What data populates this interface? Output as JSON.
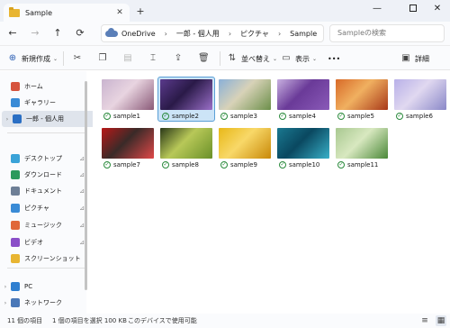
{
  "window": {
    "tab_title": "Sample",
    "tab_close": "✕",
    "new_tab": "+",
    "minimize": "—",
    "close": "✕"
  },
  "address": {
    "back": "←",
    "forward": "→",
    "up": "↑",
    "refresh": "⟳",
    "breadcrumb": [
      "OneDrive",
      "一郎 - 個人用",
      "ピクチャ",
      "Sample"
    ],
    "separator": "›",
    "search_placeholder": "Sampleの検索"
  },
  "toolbar": {
    "new_label": "新規作成",
    "sort_label": "並べ替え",
    "view_label": "表示",
    "more_label": "•••",
    "details_label": "詳細",
    "caret": "⌄"
  },
  "sidebar": {
    "items": [
      {
        "label": "ホーム",
        "color": "#d6543e",
        "pinned": false
      },
      {
        "label": "ギャラリー",
        "color": "#3a8bd6",
        "pinned": false
      },
      {
        "label": "一郎 - 個人用",
        "color": "#2b6fc4",
        "pinned": false,
        "expand": "›"
      },
      {
        "label": "デスクトップ",
        "color": "#3aa3d8",
        "pinned": true
      },
      {
        "label": "ダウンロード",
        "color": "#2b9a5c",
        "pinned": true
      },
      {
        "label": "ドキュメント",
        "color": "#6e7f96",
        "pinned": true
      },
      {
        "label": "ピクチャ",
        "color": "#3a8bd6",
        "pinned": true
      },
      {
        "label": "ミュージック",
        "color": "#e0673a",
        "pinned": true
      },
      {
        "label": "ビデオ",
        "color": "#8a4fc8",
        "pinned": true
      },
      {
        "label": "スクリーンショット",
        "color": "#e8b532",
        "pinned": false
      },
      {
        "label": "PC",
        "color": "#2f7fd0",
        "pinned": false,
        "expand": "›"
      },
      {
        "label": "ネットワーク",
        "color": "#4a78b8",
        "pinned": false,
        "expand": "›"
      }
    ],
    "pin_glyph": "⊿"
  },
  "files": [
    {
      "name": "sample1",
      "colors": [
        "#c9b4cf",
        "#8a5a78",
        "#e8d4e0"
      ]
    },
    {
      "name": "sample2",
      "colors": [
        "#5a3a8c",
        "#9a6fc8",
        "#2a1a48"
      ]
    },
    {
      "name": "sample3",
      "colors": [
        "#8ab0d8",
        "#6c8f4a",
        "#d8d2b8"
      ]
    },
    {
      "name": "sample4",
      "colors": [
        "#c8b0e0",
        "#8a5ab8",
        "#6a3a98"
      ]
    },
    {
      "name": "sample5",
      "colors": [
        "#d86a28",
        "#a83818",
        "#f0b060"
      ]
    },
    {
      "name": "sample6",
      "colors": [
        "#b8b0e8",
        "#8a88c8",
        "#e0d8f0"
      ]
    },
    {
      "name": "sample7",
      "colors": [
        "#b81818",
        "#e04848",
        "#3a2a28"
      ]
    },
    {
      "name": "sample8",
      "colors": [
        "#2a3818",
        "#6a9028",
        "#b8c858"
      ]
    },
    {
      "name": "sample9",
      "colors": [
        "#e8b818",
        "#c88808",
        "#f8d868"
      ]
    },
    {
      "name": "sample10",
      "colors": [
        "#1a7890",
        "#38b0c8",
        "#0a4860"
      ]
    },
    {
      "name": "sample11",
      "colors": [
        "#a8c890",
        "#4a8838",
        "#d8e8c0"
      ]
    }
  ],
  "selected_file": "sample2",
  "status": {
    "count": "11 個の項目",
    "selection": "1 個の項目を選択  100 KB",
    "availability": "このデバイスで使用可能"
  }
}
